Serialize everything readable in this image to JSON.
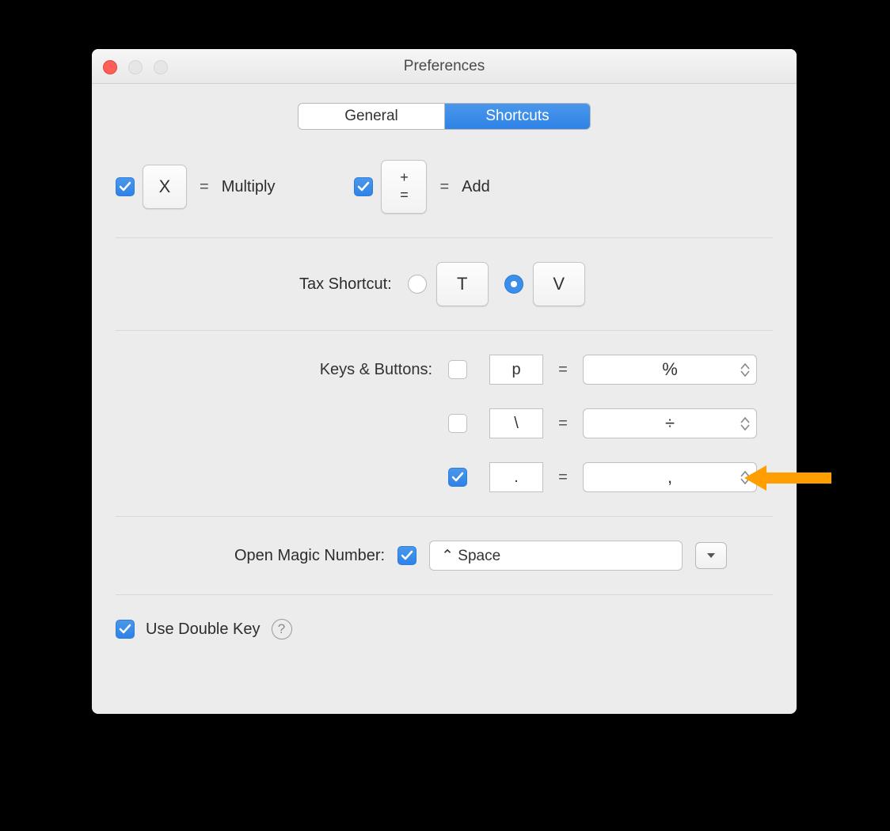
{
  "window": {
    "title": "Preferences"
  },
  "tabs": {
    "general": "General",
    "shortcuts": "Shortcuts",
    "active": "shortcuts"
  },
  "row1": {
    "multiply": {
      "checked": true,
      "key": "X",
      "eq": "=",
      "label": "Multiply"
    },
    "add": {
      "checked": true,
      "key_top": "+",
      "key_bot": "=",
      "eq": "=",
      "label": "Add"
    }
  },
  "tax": {
    "label": "Tax Shortcut:",
    "options": [
      {
        "key": "T",
        "checked": false
      },
      {
        "key": "V",
        "checked": true
      }
    ]
  },
  "kb": {
    "label": "Keys & Buttons:",
    "rows": [
      {
        "checked": false,
        "key": "p",
        "eq": "=",
        "value": "%"
      },
      {
        "checked": false,
        "key": "\\",
        "eq": "=",
        "value": "÷"
      },
      {
        "checked": true,
        "key": ".",
        "eq": "=",
        "value": ","
      }
    ]
  },
  "omn": {
    "label": "Open Magic Number:",
    "checked": true,
    "value": "⌃ Space"
  },
  "udk": {
    "checked": true,
    "label": "Use Double Key",
    "help": "?"
  }
}
